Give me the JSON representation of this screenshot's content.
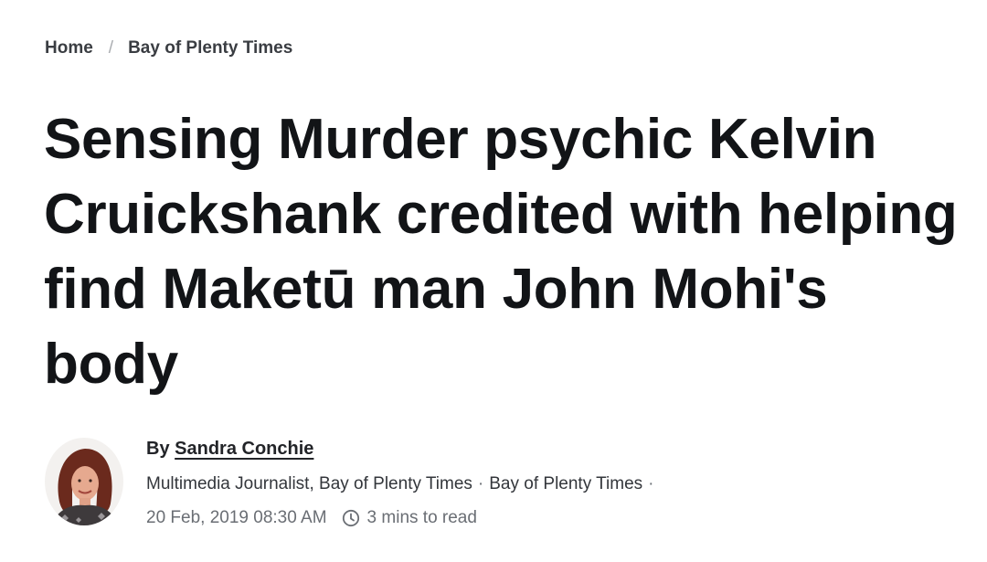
{
  "breadcrumb": {
    "home": "Home",
    "separator": "/",
    "section": "Bay of Plenty Times"
  },
  "article": {
    "headline": "Sensing Murder psychic Kelvin Cruickshank credited with helping find Maketū man John Mohi's body"
  },
  "author": {
    "by_label": "By",
    "name": "Sandra Conchie",
    "role": "Multimedia Journalist, Bay of Plenty Times",
    "separator": "·",
    "publication": "Bay of Plenty Times",
    "date": "20 Feb, 2019 08:30 AM",
    "read_time": "3 mins to read"
  },
  "icons": {
    "clock": "clock-icon",
    "avatar": "author-avatar"
  },
  "colors": {
    "text": "#16181c",
    "muted": "#6a6e74",
    "background": "#ffffff"
  }
}
